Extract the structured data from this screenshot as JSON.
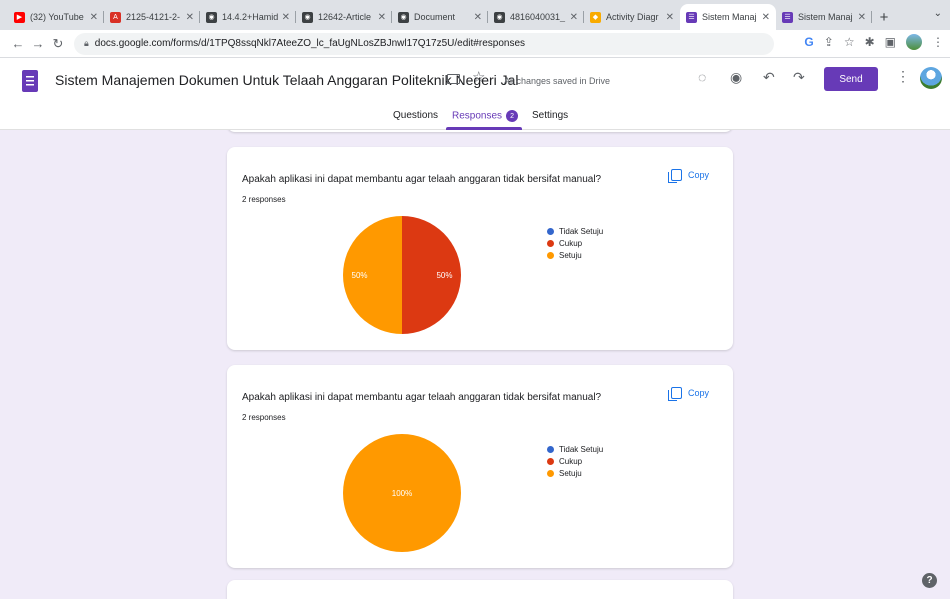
{
  "browser": {
    "tabs": [
      {
        "title": "(32) YouTube",
        "favicon_color": "#ff0000"
      },
      {
        "title": "2125-4121-2-",
        "favicon_color": "#d93025"
      },
      {
        "title": "14.4.2+Hamid",
        "favicon_color": "#3c4043"
      },
      {
        "title": "12642-Article",
        "favicon_color": "#3c4043"
      },
      {
        "title": "Document",
        "favicon_color": "#3c4043"
      },
      {
        "title": "4816040031_",
        "favicon_color": "#3c4043"
      },
      {
        "title": "Activity Diagr",
        "favicon_color": "#f9ab00"
      },
      {
        "title": "Sistem Manaj",
        "favicon_color": "#673ab7"
      },
      {
        "title": "Sistem Manaj",
        "favicon_color": "#673ab7"
      }
    ],
    "url": "docs.google.com/forms/d/1TPQ8ssqNkl7AteeZO_lc_faUgNLosZBJnwl17Q17z5U/edit#responses"
  },
  "form": {
    "title": "Sistem Manajemen Dokumen Untuk Telaah Anggaran Politeknik Negeri Jal",
    "save_status": "All changes saved in Drive",
    "send_label": "Send",
    "tabs": {
      "questions": "Questions",
      "responses": "Responses",
      "responses_count": "2",
      "settings": "Settings"
    }
  },
  "chart_data": [
    {
      "type": "pie",
      "title": "Apakah aplikasi ini dapat membantu agar telaah anggaran tidak bersifat manual?",
      "subtitle": "2 responses",
      "categories": [
        "Tidak Setuju",
        "Cukup",
        "Setuju"
      ],
      "values": [
        0,
        50,
        50
      ],
      "labels": [
        "",
        "50%",
        "50%"
      ],
      "colors": [
        "#3366cc",
        "#dc3912",
        "#ff9900"
      ],
      "legend": "right",
      "copy_label": "Copy"
    },
    {
      "type": "pie",
      "title": "Apakah aplikasi ini dapat membantu agar telaah anggaran tidak bersifat manual?",
      "subtitle": "2 responses",
      "categories": [
        "Tidak Setuju",
        "Cukup",
        "Setuju"
      ],
      "values": [
        0,
        0,
        100
      ],
      "labels": [
        "",
        "",
        "100%"
      ],
      "colors": [
        "#3366cc",
        "#dc3912",
        "#ff9900"
      ],
      "legend": "right",
      "copy_label": "Copy"
    }
  ]
}
